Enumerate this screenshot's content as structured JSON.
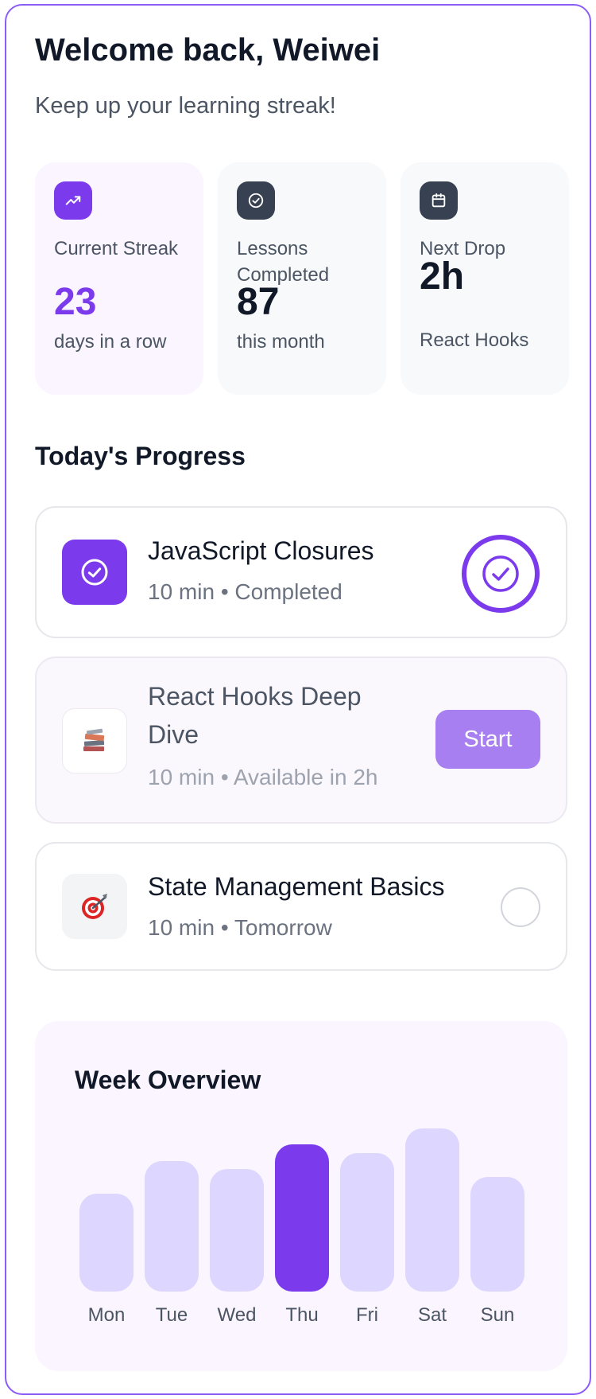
{
  "header": {
    "welcome": "Welcome back, Weiwei",
    "subtitle": "Keep up your learning streak!"
  },
  "stats": [
    {
      "icon": "trending-up-icon",
      "label": "Current Streak",
      "value": "23",
      "sub": "days in a row"
    },
    {
      "icon": "check-circle-icon",
      "label": "Lessons Completed",
      "value": "87",
      "sub": "this month"
    },
    {
      "icon": "calendar-icon",
      "label": "Next Drop",
      "value": "2h",
      "sub": "React Hooks"
    }
  ],
  "progress": {
    "title": "Today's Progress",
    "lessons": [
      {
        "icon": "check-circle-icon",
        "title": "JavaScript Closures",
        "meta": "10 min • Completed",
        "status": "completed"
      },
      {
        "icon": "books-icon",
        "title": "React Hooks Deep Dive",
        "meta": "10 min • Available in 2h",
        "status": "upcoming",
        "action": "Start"
      },
      {
        "icon": "target-icon",
        "title": "State Management Basics",
        "meta": "10 min • Tomorrow",
        "status": "pending"
      }
    ]
  },
  "week": {
    "title": "Week Overview",
    "days": [
      "Mon",
      "Tue",
      "Wed",
      "Thu",
      "Fri",
      "Sat",
      "Sun"
    ],
    "values": [
      0.6,
      0.8,
      0.75,
      0.9,
      0.85,
      1.0,
      0.7
    ],
    "highlighted_day": "Thu"
  },
  "colors": {
    "accent": "#7c3aed",
    "accent_light": "#ddd6fe",
    "border": "#8b5cf6"
  }
}
